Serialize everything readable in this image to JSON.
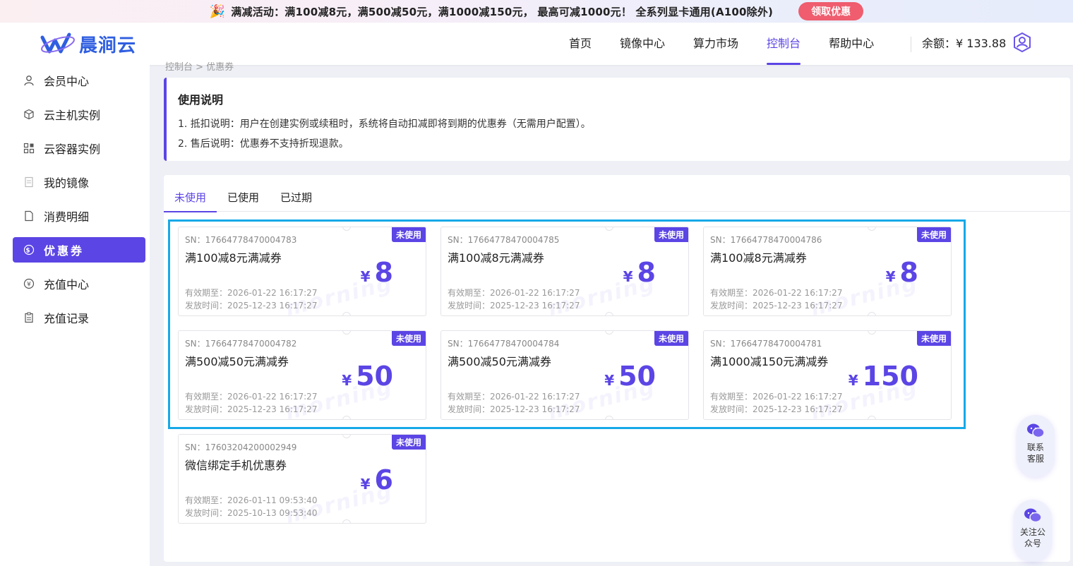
{
  "promo": {
    "text": "满减活动：满100减8元，满500减50元，满1000减150元， 最高可减1000元！ 全系列显卡通用(A100除外)",
    "button": "领取优惠"
  },
  "header": {
    "logo_text": "晨涧云",
    "nav": [
      "首页",
      "镜像中心",
      "算力市场",
      "控制台",
      "帮助中心"
    ],
    "active_nav": "控制台",
    "balance": "余额：¥ 133.88"
  },
  "sidebar": {
    "items": [
      {
        "label": "会员中心",
        "icon": "user-icon"
      },
      {
        "label": "云主机实例",
        "icon": "cube-icon"
      },
      {
        "label": "云容器实例",
        "icon": "container-icon"
      },
      {
        "label": "我的镜像",
        "icon": "image-file-icon"
      },
      {
        "label": "消费明细",
        "icon": "document-icon"
      },
      {
        "label": "优惠券",
        "icon": "dollar-circle-icon"
      },
      {
        "label": "充值中心",
        "icon": "yen-circle-icon"
      },
      {
        "label": "充值记录",
        "icon": "clipboard-icon"
      }
    ],
    "active": "优惠券"
  },
  "breadcrumb": "控制台 > 优惠券",
  "notice": {
    "title": "使用说明",
    "line1": "1. 抵扣说明：用户在创建实例或续租时，系统将自动扣减即将到期的优惠券（无需用户配置）。",
    "line2": "2. 售后说明：优惠券不支持折现退款。"
  },
  "tabs": [
    "未使用",
    "已使用",
    "已过期"
  ],
  "active_tab": "未使用",
  "coupons": [
    {
      "sn": "SN：17664778470004783",
      "name": "满100减8元满减券",
      "yen": "¥",
      "amount": "8",
      "badge": "未使用",
      "expire": "有效期至：2026-01-22 16:17:27",
      "issued": "发放时间：2025-12-23 16:17:27"
    },
    {
      "sn": "SN：17664778470004785",
      "name": "满100减8元满减券",
      "yen": "¥",
      "amount": "8",
      "badge": "未使用",
      "expire": "有效期至：2026-01-22 16:17:27",
      "issued": "发放时间：2025-12-23 16:17:27"
    },
    {
      "sn": "SN：17664778470004786",
      "name": "满100减8元满减券",
      "yen": "¥",
      "amount": "8",
      "badge": "未使用",
      "expire": "有效期至：2026-01-22 16:17:27",
      "issued": "发放时间：2025-12-23 16:17:27"
    },
    {
      "sn": "SN：17664778470004782",
      "name": "满500减50元满减券",
      "yen": "¥",
      "amount": "50",
      "badge": "未使用",
      "expire": "有效期至：2026-01-22 16:17:27",
      "issued": "发放时间：2025-12-23 16:17:27"
    },
    {
      "sn": "SN：17664778470004784",
      "name": "满500减50元满减券",
      "yen": "¥",
      "amount": "50",
      "badge": "未使用",
      "expire": "有效期至：2026-01-22 16:17:27",
      "issued": "发放时间：2025-12-23 16:17:27"
    },
    {
      "sn": "SN：17664778470004781",
      "name": "满1000减150元满减券",
      "yen": "¥",
      "amount": "150",
      "badge": "未使用",
      "expire": "有效期至：2026-01-22 16:17:27",
      "issued": "发放时间：2025-12-23 16:17:27"
    },
    {
      "sn": "SN：17603204200002949",
      "name": "微信绑定手机优惠券",
      "yen": "¥",
      "amount": "6",
      "badge": "未使用",
      "expire": "有效期至：2026-01-11 09:53:40",
      "issued": "发放时间：2025-10-13 09:53:40"
    }
  ],
  "watermark": "morning",
  "float_buttons": [
    {
      "label": "联系客服",
      "icon": "wechat-icon"
    },
    {
      "label": "关注公众号",
      "icon": "wechat-icon"
    }
  ],
  "colors": {
    "accent": "#5b45e5",
    "highlight": "#17a9e8",
    "promo_button": "#ef5d6e",
    "logo": "#2f5ee0"
  }
}
